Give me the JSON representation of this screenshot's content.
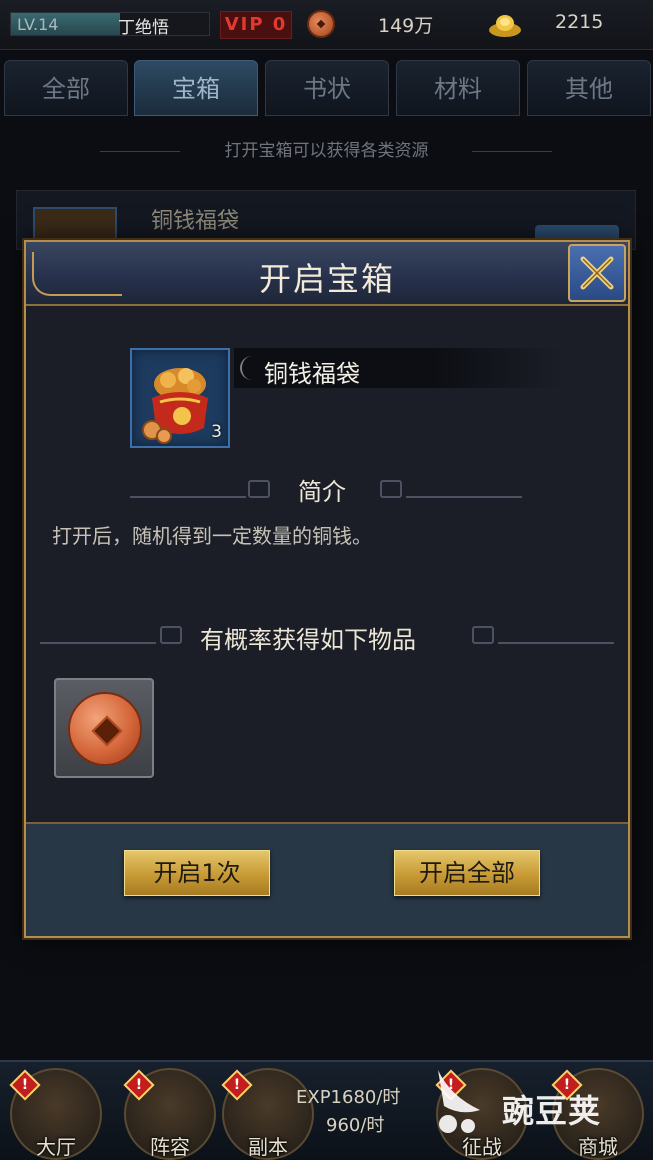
{
  "topbar": {
    "level": "LV.14",
    "level_progress": 0.55,
    "player_name": "丁绝悟",
    "vip": "VIP 0",
    "copper": "149万",
    "gold": "2215",
    "icons": {
      "copper": "copper-coin-icon",
      "gold": "gold-ingot-icon"
    }
  },
  "tabs": [
    {
      "label": "全部",
      "active": false
    },
    {
      "label": "宝箱",
      "active": true
    },
    {
      "label": "书状",
      "active": false
    },
    {
      "label": "材料",
      "active": false
    },
    {
      "label": "其他",
      "active": false
    }
  ],
  "bag": {
    "hint": "打开宝箱可以获得各类资源",
    "item_name": "铜钱福袋"
  },
  "modal": {
    "title": "开启宝箱",
    "item": {
      "name": "铜钱福袋",
      "count": "3",
      "icon": "money-bag-icon"
    },
    "intro_title": "简介",
    "description": "打开后，随机得到一定数量的铜钱。",
    "drops_title": "有概率获得如下物品",
    "drops": [
      {
        "icon": "copper-coin-icon"
      }
    ],
    "buttons": {
      "open_once": "开启1次",
      "open_all": "开启全部"
    }
  },
  "bottom_nav": {
    "items": [
      {
        "label": "大厅",
        "alert": "!"
      },
      {
        "label": "阵容",
        "alert": "!"
      },
      {
        "label": "副本",
        "alert": "!"
      },
      {
        "label": "征战",
        "alert": "!"
      },
      {
        "label": "商城",
        "alert": "!"
      }
    ],
    "exp_rate": "EXP1680/时",
    "copper_rate": "960/时"
  },
  "watermark": "豌豆荚",
  "colors": {
    "accent_gold": "#c79a35",
    "frame": "#b68d4a",
    "vip_red": "#e13a2e"
  }
}
